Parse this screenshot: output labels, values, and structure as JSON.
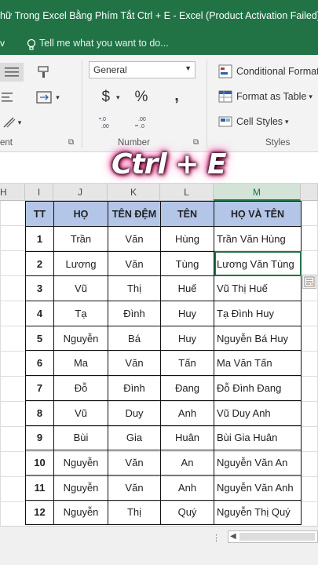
{
  "window": {
    "title": "hữ Trong Excel Bằng Phím Tắt Ctrl + E  -  Excel (Product Activation Failed)",
    "view_tab_fragment": "v",
    "tell_me": "Tell me what you want to do..."
  },
  "ribbon": {
    "number_format": "General",
    "currency_symbol": "$",
    "percent_symbol": "%",
    "comma_symbol": ",",
    "alignment_group_fragment": "ent",
    "number_group_label": "Number",
    "styles_group_label": "Styles",
    "conditional_formatting": "Conditional Formatti",
    "format_as_table": "Format as Table",
    "cell_styles": "Cell Styles"
  },
  "overlay_text": "Ctrl + E",
  "columns": [
    "H",
    "I",
    "J",
    "K",
    "L",
    "M"
  ],
  "table": {
    "headers": [
      "TT",
      "HỌ",
      "TÊN ĐỆM",
      "TÊN",
      "HỌ VÀ TÊN"
    ],
    "rows": [
      [
        "1",
        "Trần",
        "Văn",
        "Hùng",
        "Trần Văn Hùng"
      ],
      [
        "2",
        "Lương",
        "Văn",
        "Tùng",
        "Lương Văn Tùng"
      ],
      [
        "3",
        "Vũ",
        "Thị",
        "Huế",
        "Vũ Thị Huế"
      ],
      [
        "4",
        "Tạ",
        "Đình",
        "Huy",
        "Tạ Đình Huy"
      ],
      [
        "5",
        "Nguyễn",
        "Bá",
        "Huy",
        "Nguyễn Bá Huy"
      ],
      [
        "6",
        "Ma",
        "Văn",
        "Tấn",
        "Ma Văn Tấn"
      ],
      [
        "7",
        "Đỗ",
        "Đình",
        "Đang",
        "Đỗ Đình Đang"
      ],
      [
        "8",
        "Vũ",
        "Duy",
        "Anh",
        "Vũ Duy Anh"
      ],
      [
        "9",
        "Bùi",
        "Gia",
        "Huân",
        "Bùi Gia Huân"
      ],
      [
        "10",
        "Nguyễn",
        "Văn",
        "An",
        "Nguyễn Văn An"
      ],
      [
        "11",
        "Nguyễn",
        "Văn",
        "Anh",
        "Nguyễn Văn Anh"
      ],
      [
        "12",
        "Nguyễn",
        "Thị",
        "Quý",
        "Nguyễn Thị Quý"
      ]
    ],
    "active_row": 1
  },
  "colors": {
    "excel_green": "#217346",
    "header_fill": "#b4c6e7",
    "overlay_glow": "#ff2d96"
  },
  "icons": [
    "lightbulb-icon",
    "align-icon",
    "format-painter-icon",
    "merge-cells-icon",
    "orientation-icon",
    "increase-decimal-icon",
    "decrease-decimal-icon",
    "dialog-launcher-icon",
    "conditional-formatting-icon",
    "format-as-table-icon",
    "cell-styles-icon",
    "flash-fill-options-icon"
  ]
}
